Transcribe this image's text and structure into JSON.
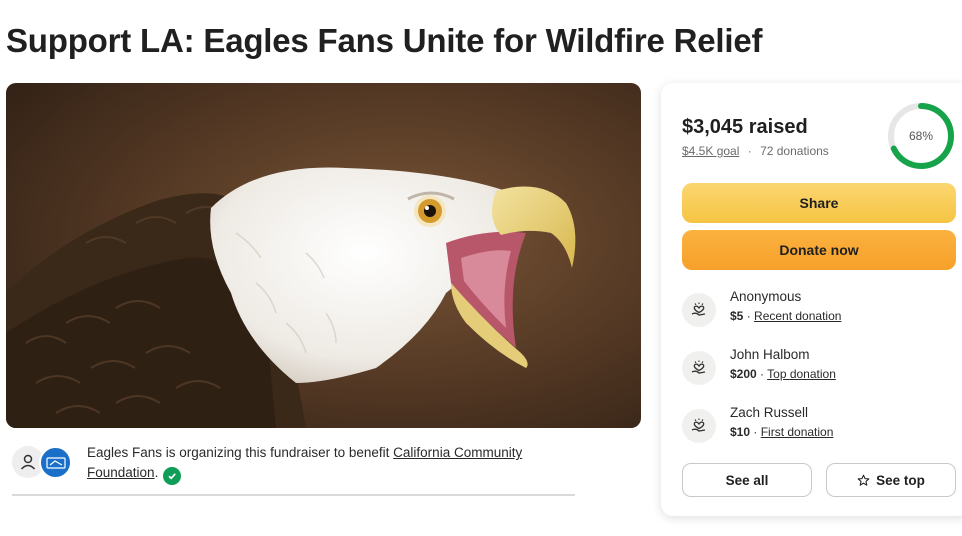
{
  "page": {
    "title": "Support LA: Eagles Fans Unite for Wildfire Relief"
  },
  "hero": {
    "image_icon": "bald-eagle-photo"
  },
  "organizer": {
    "text_before": "Eagles Fans is organizing this fundraiser to benefit ",
    "beneficiary": "California Community Foundation",
    "text_after": "."
  },
  "donation_card": {
    "raised": "$3,045 raised",
    "goal": "$4.5K goal",
    "separator": "·",
    "donations_count": "72 donations",
    "progress_label": "68%",
    "progress": 0.68,
    "share_label": "Share",
    "donate_label": "Donate now",
    "donations": [
      {
        "name": "Anonymous",
        "amount": "$5",
        "dot": " · ",
        "tag": "Recent donation"
      },
      {
        "name": "John Halbom",
        "amount": "$200",
        "dot": " · ",
        "tag": "Top donation"
      },
      {
        "name": "Zach Russell",
        "amount": "$10",
        "dot": " · ",
        "tag": "First donation"
      }
    ],
    "see_all_label": "See all",
    "see_top_label": "See top"
  },
  "colors": {
    "progress_green": "#16a34a",
    "progress_track": "#e6e6e6",
    "share_yellow": "#f6c443",
    "donate_orange": "#f6a02a",
    "verified_green": "#0f9d58",
    "charity_blue": "#1a6fc9"
  }
}
